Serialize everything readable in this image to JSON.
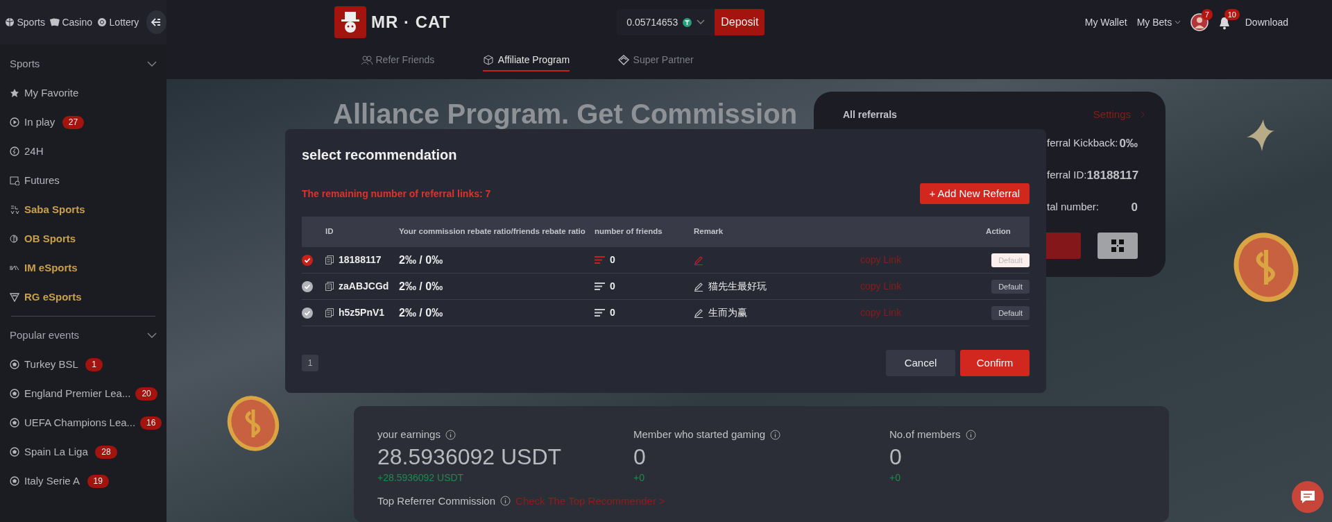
{
  "top_nav": {
    "links": [
      {
        "label": "Sports"
      },
      {
        "label": "Casino"
      },
      {
        "label": "Lottery"
      }
    ]
  },
  "logo": {
    "text": "MR · CAT"
  },
  "balance": {
    "amount": "0.05714653",
    "deposit": "Deposit"
  },
  "user_nav": {
    "wallet": "My Wallet",
    "bets": "My Bets",
    "avatar_badge": "7",
    "bell_badge": "10",
    "download": "Download"
  },
  "sub_tabs": [
    {
      "label": "Refer Friends",
      "selected": false
    },
    {
      "label": "Affiliate Program",
      "selected": true
    },
    {
      "label": "Super Partner",
      "selected": false
    }
  ],
  "sidebar": {
    "sections": [
      {
        "title": "Sports",
        "items": [
          {
            "label": "My Favorite",
            "highlighted": false
          },
          {
            "label": "In play",
            "badge": "27",
            "highlighted": false
          },
          {
            "label": "24H",
            "highlighted": false
          },
          {
            "label": "Futures",
            "highlighted": false
          },
          {
            "label": "Saba Sports",
            "highlighted": true
          },
          {
            "label": "OB Sports",
            "highlighted": true
          },
          {
            "label": "IM eSports",
            "highlighted": true
          },
          {
            "label": "RG eSports",
            "highlighted": true
          }
        ]
      },
      {
        "title": "Popular events",
        "items": [
          {
            "label": "Turkey BSL",
            "badge": "1",
            "highlighted": false
          },
          {
            "label": "England Premier Lea...",
            "badge": "20",
            "highlighted": false
          },
          {
            "label": "UEFA Champions Lea...",
            "badge": "16",
            "highlighted": false
          },
          {
            "label": "Spain La Liga",
            "badge": "28",
            "highlighted": false
          },
          {
            "label": "Italy Serie A",
            "badge": "19",
            "highlighted": false
          }
        ]
      }
    ]
  },
  "hero": {
    "title": "Alliance Program. Get Commission"
  },
  "referral_card": {
    "title": "All referrals",
    "settings": "Settings",
    "rows": [
      {
        "label": "ferral Kickback:",
        "value": "0‰"
      },
      {
        "label": "ferral ID:",
        "value": "18188117"
      },
      {
        "label": "tal number:",
        "value": "0"
      }
    ]
  },
  "stats": {
    "items": [
      {
        "label": "your earnings",
        "value": "28.5936092 USDT",
        "change": "+28.5936092 USDT"
      },
      {
        "label": "Member who started gaming",
        "value": "0",
        "change": "+0"
      },
      {
        "label": "No.of members",
        "value": "0",
        "change": "+0"
      }
    ],
    "top_referrer": {
      "label": "Top Referrer Commission",
      "link": "Check The Top Recommender >"
    }
  },
  "modal": {
    "title": "select recommendation",
    "remaining": "The remaining number of referral links: 7",
    "add_button": "+ Add New Referral",
    "columns": [
      "ID",
      "Your commission rebate ratio/friends rebate ratio",
      "number of friends",
      "Remark",
      "Action"
    ],
    "rows": [
      {
        "selected": true,
        "id": "18188117",
        "ratio": "2‰ / 0‰",
        "friends": "0",
        "copy": "copy Link",
        "action": "Default"
      },
      {
        "selected": false,
        "id": "zaABJCGd",
        "ratio": "2‰ / 0‰",
        "friends": "0",
        "remark": "猫先生最好玩",
        "copy": "copy Link",
        "action": "Default"
      },
      {
        "selected": false,
        "id": "h5z5PnV1",
        "ratio": "2‰ / 0‰",
        "friends": "0",
        "remark": "生而为赢",
        "copy": "copy Link",
        "action": "Default"
      }
    ],
    "page": "1",
    "cancel": "Cancel",
    "confirm": "Confirm"
  }
}
